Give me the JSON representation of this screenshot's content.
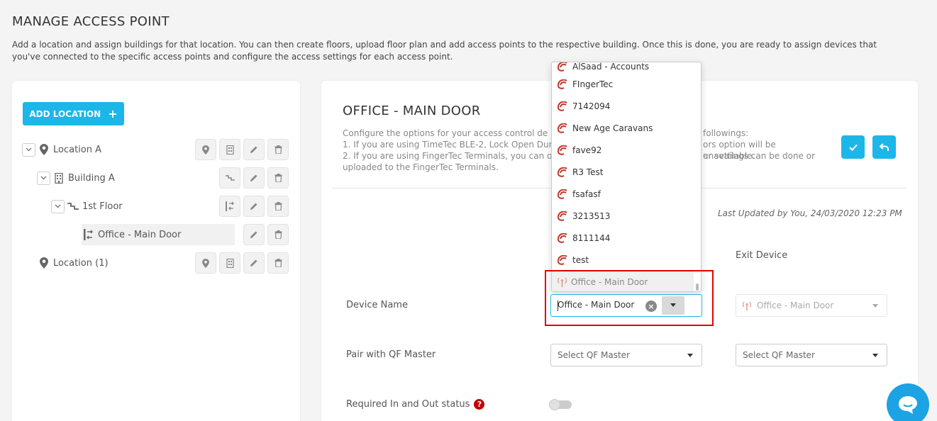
{
  "page": {
    "title": "MANAGE ACCESS POINT",
    "description": "Add a location and assign buildings for that location. You can then create floors, upload floor plan and add access points to the respective building. Once this is done, you are ready to assign devices that you've connected to the specific access points and configure the access settings for each access point."
  },
  "tree": {
    "add_location_label": "ADD LOCATION",
    "add_location_icon": "plus-icon",
    "nodes": [
      {
        "label": "Location A",
        "icon": "map-pin-icon"
      },
      {
        "label": "Building A",
        "icon": "building-icon"
      },
      {
        "label": "1st Floor",
        "icon": "stairs-icon"
      },
      {
        "label": "Office - Main Door",
        "icon": "door-icon"
      },
      {
        "label": "Location (1)",
        "icon": "map-pin-icon"
      }
    ]
  },
  "detail": {
    "title": "OFFICE - MAIN DOOR",
    "description_lines": [
      "Configure the options for your access control de",
      "1. If you are using TimeTec BLE-2, Lock Open Duratio",
      "2. If you are using FingerTec Terminals, you can only",
      "uploaded to the FingerTec Terminals."
    ],
    "description_right_lines": [
      "followings:",
      "ors option will be unavailable.",
      "er settings can be done or"
    ],
    "save_icon": "check-icon",
    "back_icon": "undo-icon",
    "last_updated": "Last Updated by You, 24/03/2020 12:23 PM",
    "exit_device_header": "Exit Device",
    "device_name_label": "Device Name",
    "entry_device_value": "Office - Main Door",
    "exit_device_value": "Office - Main Door",
    "pair_label": "Pair with QF Master",
    "pair_entry_placeholder": "Select QF Master",
    "pair_exit_placeholder": "Select QF Master",
    "inout_label": "Required In and Out status",
    "help_glyph": "?",
    "inout_enabled": false
  },
  "dropdown": {
    "partial_item": "AlSaad - Accounts",
    "items": [
      "FIngerTec",
      "7142094",
      "New Age Caravans",
      "fave92",
      "R3 Test",
      "fsafasf",
      "3213513",
      "8111144",
      "test"
    ],
    "active_item": "Office - Main Door"
  },
  "colors": {
    "accent": "#1cb6e8",
    "highlight": "#e30000",
    "brand_logo": "#c0392b"
  }
}
